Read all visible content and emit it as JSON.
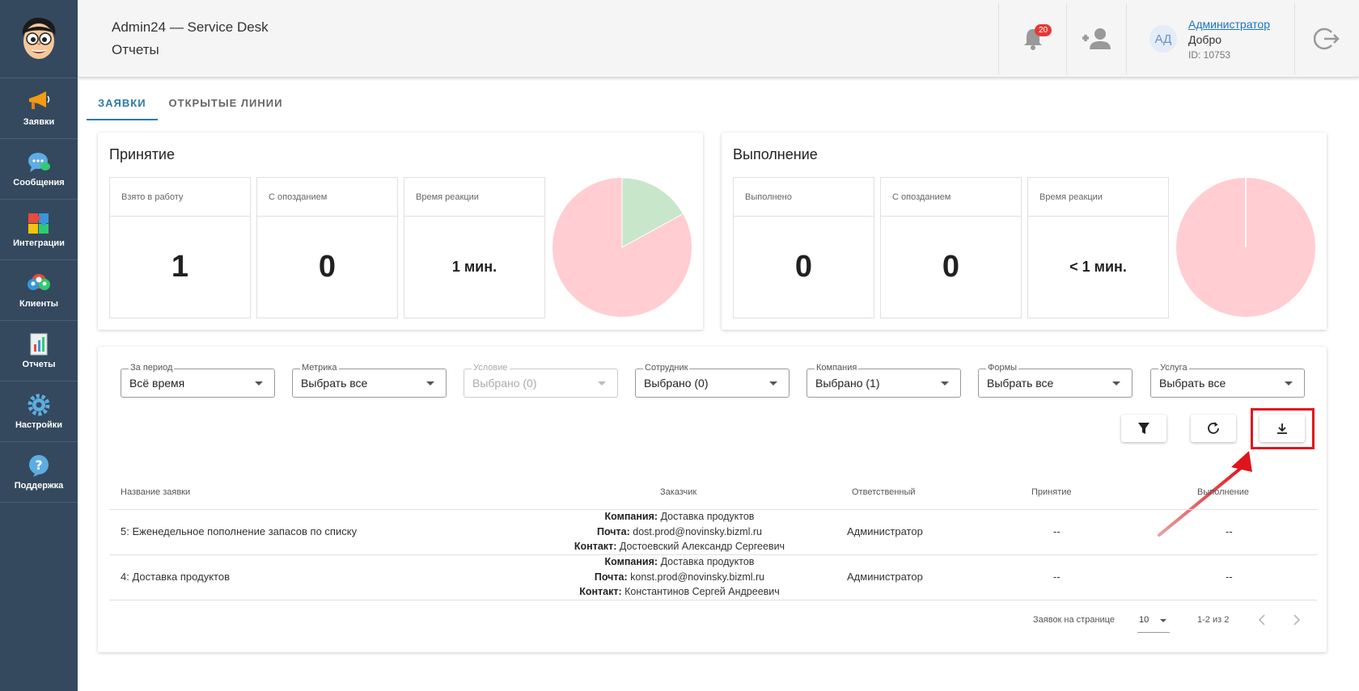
{
  "sidebar": {
    "items": [
      {
        "label": "Заявки",
        "icon": "megaphone-icon"
      },
      {
        "label": "Сообщения",
        "icon": "chat-bubbles-icon"
      },
      {
        "label": "Интеграции",
        "icon": "puzzle-icon"
      },
      {
        "label": "Клиенты",
        "icon": "clients-icon"
      },
      {
        "label": "Отчеты",
        "icon": "report-icon"
      },
      {
        "label": "Настройки",
        "icon": "gear-icon"
      },
      {
        "label": "Поддержка",
        "icon": "help-icon"
      }
    ]
  },
  "header": {
    "title": "Admin24 — Service Desk",
    "subtitle": "Отчеты",
    "notification_count": "20",
    "user": {
      "initials": "АД",
      "name": "Администратор",
      "greeting": "Добро",
      "id": "ID: 10753"
    }
  },
  "tabs": [
    {
      "label": "ЗАЯВКИ",
      "active": true
    },
    {
      "label": "ОТКРЫТЫЕ ЛИНИИ",
      "active": false
    }
  ],
  "acceptance": {
    "title": "Принятие",
    "stats": [
      {
        "label": "Взято в работу",
        "value": "1"
      },
      {
        "label": "С опозданием",
        "value": "0"
      },
      {
        "label": "Время реакции",
        "value": "1 мин."
      }
    ],
    "pie": {
      "green_fraction": 0.17
    }
  },
  "execution": {
    "title": "Выполнение",
    "stats": [
      {
        "label": "Выполнено",
        "value": "0"
      },
      {
        "label": "С опозданием",
        "value": "0"
      },
      {
        "label": "Время реакции",
        "value": "< 1 мин."
      }
    ],
    "pie": {
      "green_fraction": 0.0
    }
  },
  "filters": [
    {
      "label": "За период",
      "value": "Всё время",
      "disabled": false
    },
    {
      "label": "Метрика",
      "value": "Выбрать все",
      "disabled": false
    },
    {
      "label": "Условие",
      "value": "Выбрано (0)",
      "disabled": true
    },
    {
      "label": "Сотрудник",
      "value": "Выбрано (0)",
      "disabled": false
    },
    {
      "label": "Компания",
      "value": "Выбрано (1)",
      "disabled": false
    },
    {
      "label": "Формы",
      "value": "Выбрать все",
      "disabled": false
    },
    {
      "label": "Услуга",
      "value": "Выбрать все",
      "disabled": false
    }
  ],
  "table": {
    "headers": {
      "name": "Название заявки",
      "customer": "Заказчик",
      "responsible": "Ответственный",
      "acceptance": "Принятие",
      "execution": "Выполнение"
    },
    "customer_labels": {
      "company": "Компания:",
      "email": "Почта:",
      "contact": "Контакт:"
    },
    "rows": [
      {
        "name": "5: Еженедельное пополнение запасов по списку",
        "company": "Доставка продуктов",
        "email": "dost.prod@novinsky.bizml.ru",
        "contact": "Достоевский Александр Сергеевич",
        "responsible": "Администратор",
        "acceptance": "--",
        "execution": "--"
      },
      {
        "name": "4: Доставка продуктов",
        "company": "Доставка продуктов",
        "email": "konst.prod@novinsky.bizml.ru",
        "contact": "Константинов Сергей Андреевич",
        "responsible": "Администратор",
        "acceptance": "--",
        "execution": "--"
      }
    ]
  },
  "pager": {
    "per_page_label": "Заявок на странице",
    "per_page_value": "10",
    "range": "1-2 из 2"
  },
  "colors": {
    "sidebar": "#34495e",
    "pie_red": "#ffcdd2",
    "pie_green": "#c8e6c9",
    "highlight": "#e0141b",
    "accent": "#2e7aa8"
  }
}
